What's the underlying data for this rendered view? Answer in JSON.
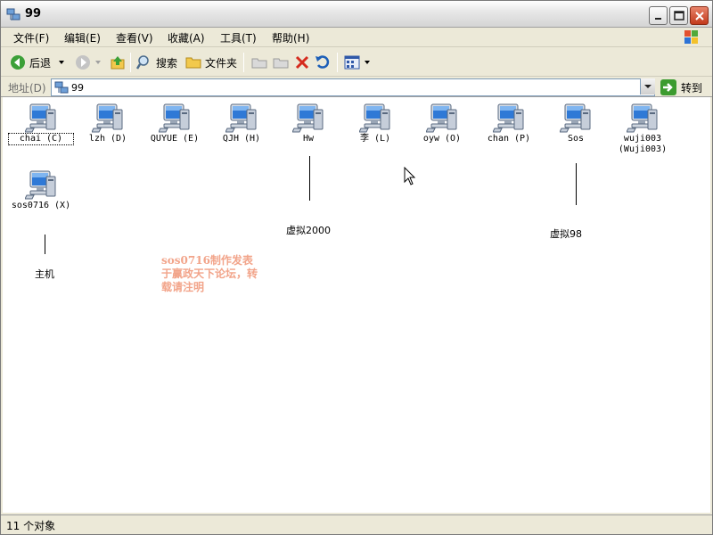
{
  "window": {
    "title": "99"
  },
  "menu": [
    "文件(F)",
    "编辑(E)",
    "查看(V)",
    "收藏(A)",
    "工具(T)",
    "帮助(H)"
  ],
  "toolbar": {
    "back": "后退",
    "search": "搜索",
    "folders": "文件夹"
  },
  "address": {
    "label": "地址(D)",
    "value": "99",
    "go": "转到"
  },
  "items": [
    {
      "label": "chai (C)"
    },
    {
      "label": "lzh (D)"
    },
    {
      "label": "QUYUE (E)"
    },
    {
      "label": "QJH (H)"
    },
    {
      "label": "Hw"
    },
    {
      "label": "李 (L)"
    },
    {
      "label": "oyw (O)"
    },
    {
      "label": "chan (P)"
    },
    {
      "label": "Sos"
    },
    {
      "label": "wuji003\n(Wuji003)"
    },
    {
      "label": "sos0716 (X)"
    }
  ],
  "annotations": {
    "host": "主机",
    "virtual2000": "虚拟2000",
    "virtual98": "虚拟98"
  },
  "watermark": "sos0716制作发表于赢政天下论坛，转载请注明",
  "status": {
    "text": "11 个对象"
  },
  "colors": {
    "titlebar": "#d4d4d4",
    "watermark": "#f2a48a",
    "chrome": "#ece9d8"
  }
}
